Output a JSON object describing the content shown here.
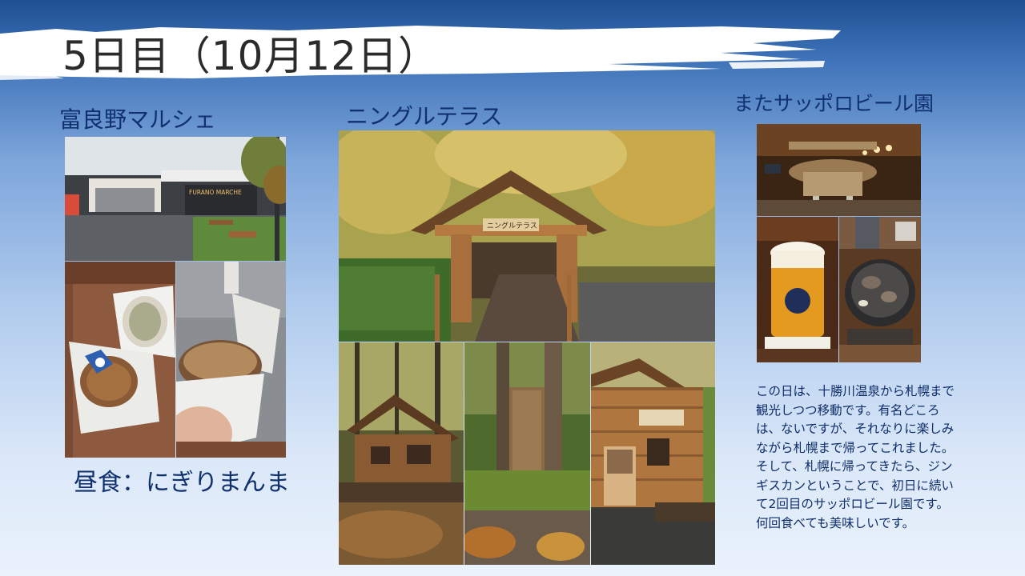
{
  "slide": {
    "title": "5日目（10月12日）",
    "sections": {
      "left": {
        "heading": "富良野マルシェ",
        "photo_sign": "FURANO MARCHE",
        "caption": "昼食：にぎりまんま"
      },
      "middle": {
        "heading": "ニングルテラス",
        "photo_sign": "ニングルテラス"
      },
      "right": {
        "heading": "またサッポロビール園",
        "description": "この日は、十勝川温泉から札幌まで観光しつつ移動です。有名どころは、ないですが、それなりに楽しみながら札幌まで帰ってこれました。そして、札幌に帰ってきたら、ジンギスカンということで、初日に続いて2回目のサッポロビール園です。何回食べても美味しいです。"
      }
    }
  },
  "colors": {
    "heading": "#10306e",
    "title": "#2b2b2b",
    "background_top": "#1f4f93",
    "background_bottom": "#eaf2fc"
  }
}
